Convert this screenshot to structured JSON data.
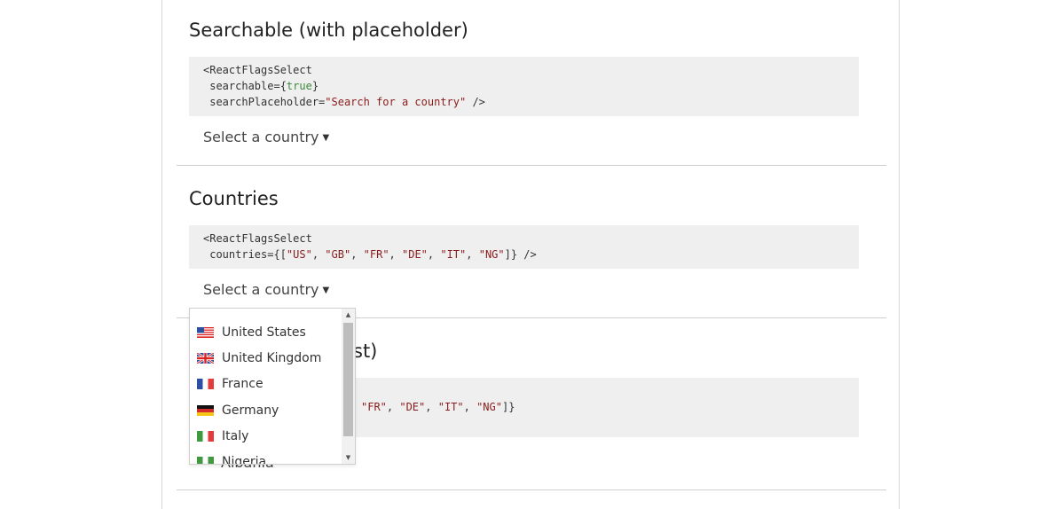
{
  "sections": [
    {
      "title": "Searchable (with placeholder)",
      "code_lines": [
        {
          "parts": [
            {
              "t": "<ReactFlagsSelect",
              "c": ""
            }
          ]
        },
        {
          "parts": [
            {
              "t": " searchable={",
              "c": ""
            },
            {
              "t": "true",
              "c": "bool"
            },
            {
              "t": "}",
              "c": ""
            }
          ]
        },
        {
          "parts": [
            {
              "t": " searchPlaceholder=",
              "c": ""
            },
            {
              "t": "\"Search for a country\"",
              "c": "str"
            },
            {
              "t": " />",
              "c": ""
            }
          ]
        }
      ],
      "select_label": "Select a country"
    },
    {
      "title": "Countries",
      "code_lines": [
        {
          "parts": [
            {
              "t": "<ReactFlagsSelect",
              "c": ""
            }
          ]
        },
        {
          "parts": [
            {
              "t": " countries={[",
              "c": ""
            },
            {
              "t": "\"US\"",
              "c": "str"
            },
            {
              "t": ", ",
              "c": ""
            },
            {
              "t": "\"GB\"",
              "c": "str"
            },
            {
              "t": ", ",
              "c": ""
            },
            {
              "t": "\"FR\"",
              "c": "str"
            },
            {
              "t": ", ",
              "c": ""
            },
            {
              "t": "\"DE\"",
              "c": "str"
            },
            {
              "t": ", ",
              "c": ""
            },
            {
              "t": "\"IT\"",
              "c": "str"
            },
            {
              "t": ", ",
              "c": ""
            },
            {
              "t": "\"NG\"",
              "c": "str"
            },
            {
              "t": "]} />",
              "c": ""
            }
          ]
        }
      ],
      "select_label": "Select a country"
    },
    {
      "title_visible_fragment": "st)",
      "code_visible_parts": [
        {
          "t": "\"FR\"",
          "c": "str"
        },
        {
          "t": ", ",
          "c": ""
        },
        {
          "t": "\"DE\"",
          "c": "str"
        },
        {
          "t": ", ",
          "c": ""
        },
        {
          "t": "\"IT\"",
          "c": "str"
        },
        {
          "t": ", ",
          "c": ""
        },
        {
          "t": "\"NG\"",
          "c": "str"
        },
        {
          "t": "]}",
          "c": ""
        }
      ],
      "select_visible_fragment": "Albania"
    }
  ],
  "dropdown": {
    "items": [
      {
        "label": "United States",
        "flag": "us-flag-icon"
      },
      {
        "label": "United Kingdom",
        "flag": "gb-flag-icon"
      },
      {
        "label": "France",
        "flag": "fr-flag-icon"
      },
      {
        "label": "Germany",
        "flag": "de-flag-icon"
      },
      {
        "label": "Italy",
        "flag": "it-flag-icon"
      },
      {
        "label": "Nigeria",
        "flag": "ng-flag-icon"
      }
    ],
    "scroll_up": "▲",
    "scroll_down": "▼"
  },
  "caret": "▼",
  "colors": {
    "code_bg": "#efefef",
    "string": "#8b1c1c",
    "boolean": "#3b8a3b",
    "divider": "#cfcfcf"
  }
}
